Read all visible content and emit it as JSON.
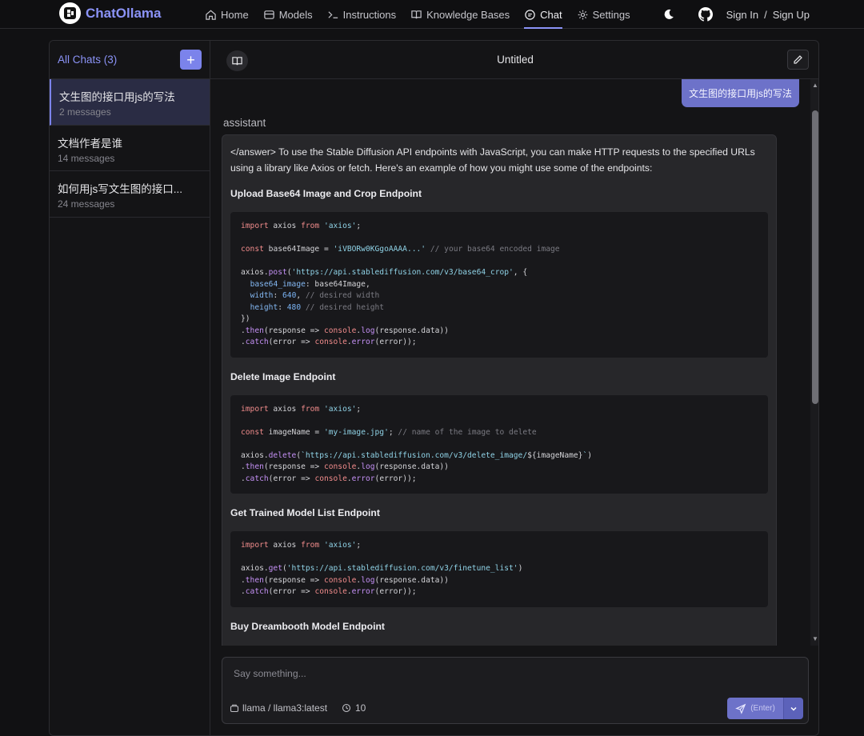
{
  "nav": {
    "brand": "ChatOllama",
    "items": [
      {
        "label": "Home",
        "icon": "home-icon"
      },
      {
        "label": "Models",
        "icon": "database-icon"
      },
      {
        "label": "Instructions",
        "icon": "terminal-icon"
      },
      {
        "label": "Knowledge Bases",
        "icon": "book-open-icon"
      },
      {
        "label": "Chat",
        "icon": "chat-bubble-icon"
      },
      {
        "label": "Settings",
        "icon": "gear-icon"
      }
    ],
    "active": "Chat",
    "sign_in": "Sign In",
    "separator": "/",
    "sign_up": "Sign Up"
  },
  "sidebar": {
    "title": "All Chats (3)",
    "new_label": "+",
    "chats": [
      {
        "title": "文生图的接口用js的写法",
        "count": "2 messages"
      },
      {
        "title": "文档作者是谁",
        "count": "14 messages"
      },
      {
        "title": "如何用js写文生图的接口...",
        "count": "24 messages"
      }
    ]
  },
  "header": {
    "title": "Untitled"
  },
  "messages": {
    "user_text": "文生图的接口用js的写法",
    "role": "assistant",
    "intro": "</answer> To use the Stable Diffusion API endpoints with JavaScript, you can make HTTP requests to the specified URLs using a library like Axios or fetch. Here's an example of how you might use some of the endpoints:",
    "sections": [
      "Upload Base64 Image and Crop Endpoint",
      "Delete Image Endpoint",
      "Get Trained Model List Endpoint",
      "Buy Dreambooth Model Endpoint"
    ]
  },
  "composer": {
    "placeholder": "Say something...",
    "model": "llama / llama3:latest",
    "context_count": "10",
    "send_hint": "(Enter)"
  },
  "colors": {
    "accent": "#7b83eb",
    "background": "#111113",
    "bubble": "#6d72c9"
  }
}
